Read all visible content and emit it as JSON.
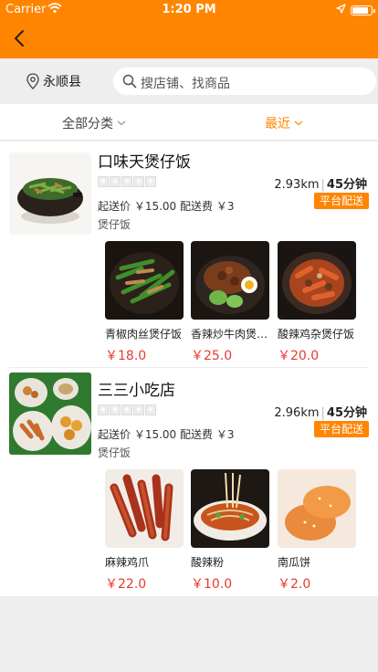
{
  "status_bar": {
    "carrier": "Carrier",
    "time": "1:20 PM",
    "battery_level": 0.9
  },
  "nav": {
    "back_icon": "chevron-left-icon"
  },
  "search": {
    "location": "永顺县",
    "placeholder": "搜店铺、找商品"
  },
  "filters": {
    "category": "全部分类",
    "sort": "最近"
  },
  "colors": {
    "brand": "#ff8500",
    "price": "#e8382f"
  },
  "shops": [
    {
      "name": "口味天煲仔饭",
      "distance": "2.93km",
      "time": "45分钟",
      "min_price": "起送价 ￥15.00",
      "delivery_fee": "配送费 ￥3",
      "badge": "平台配送",
      "category": "煲仔饭",
      "rating_stars": 5,
      "products": [
        {
          "name": "青椒肉丝煲仔饭",
          "price": "￥18.0"
        },
        {
          "name": "香辣炒牛肉煲仔饭",
          "price": "￥25.0"
        },
        {
          "name": "酸辣鸡杂煲仔饭",
          "price": "￥20.0"
        }
      ]
    },
    {
      "name": "三三小吃店",
      "distance": "2.96km",
      "time": "45分钟",
      "min_price": "起送价 ￥15.00",
      "delivery_fee": "配送费 ￥3",
      "badge": "平台配送",
      "category": "煲仔饭",
      "rating_stars": 5,
      "products": [
        {
          "name": "麻辣鸡爪",
          "price": "￥22.0"
        },
        {
          "name": "酸辣粉",
          "price": "￥10.0"
        },
        {
          "name": "南瓜饼",
          "price": "￥2.0"
        }
      ]
    }
  ]
}
